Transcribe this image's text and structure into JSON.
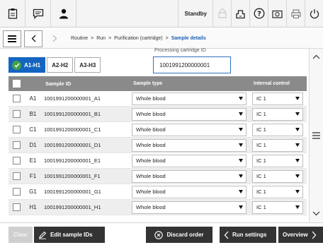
{
  "toolbar": {
    "status": "Standby"
  },
  "breadcrumb": {
    "items": [
      "Routine",
      "Run",
      "Purification (cartridge)",
      "Sample details"
    ]
  },
  "tabs": [
    "A1-H1",
    "A2-H2",
    "A3-H3"
  ],
  "processing": {
    "label": "Processing cartridge ID",
    "value": "1001991200000001"
  },
  "table": {
    "headers": {
      "sample_id": "Sample ID",
      "sample_type": "Sample type",
      "internal_control": "Internal control"
    },
    "rows": [
      {
        "well": "A1",
        "sample_id": "1001991200000001_A1",
        "sample_type": "Whole blood",
        "ic": "IC 1"
      },
      {
        "well": "B1",
        "sample_id": "1001991200000001_B1",
        "sample_type": "Whole blood",
        "ic": "IC 1"
      },
      {
        "well": "C1",
        "sample_id": "1001991200000001_C1",
        "sample_type": "Whole blood",
        "ic": "IC 1"
      },
      {
        "well": "D1",
        "sample_id": "1001991200000001_D1",
        "sample_type": "Whole blood",
        "ic": "IC 1"
      },
      {
        "well": "E1",
        "sample_id": "1001991200000001_E1",
        "sample_type": "Whole blood",
        "ic": "IC 1"
      },
      {
        "well": "F1",
        "sample_id": "1001991200000001_F1",
        "sample_type": "Whole blood",
        "ic": "IC 1"
      },
      {
        "well": "G1",
        "sample_id": "1001991200000001_G1",
        "sample_type": "Whole blood",
        "ic": "IC 1"
      },
      {
        "well": "H1",
        "sample_id": "1001991200000001_H1",
        "sample_type": "Whole blood",
        "ic": "IC 1"
      }
    ]
  },
  "bottom": {
    "clear": "Clear",
    "edit": "Edit sample IDs",
    "discard": "Discard order",
    "run_settings": "Run settings",
    "overview": "Overview"
  },
  "colors": {
    "accent": "#1565c0",
    "header_gray": "#8a8a8a",
    "button_dark": "#333333",
    "check_green": "#43a047"
  }
}
